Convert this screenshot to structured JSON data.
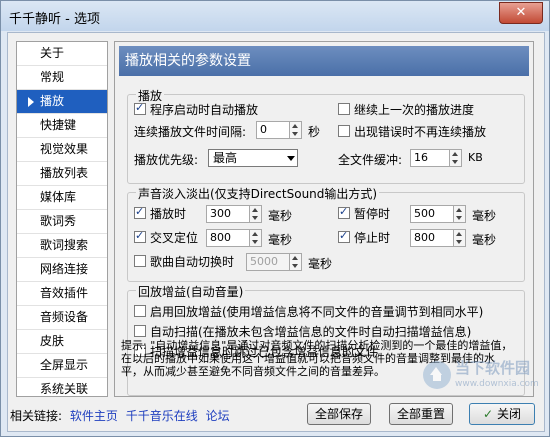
{
  "window": {
    "title": "千千静听 - 选项"
  },
  "sidebar": {
    "items": [
      {
        "label": "关于"
      },
      {
        "label": "常规"
      },
      {
        "label": "播放",
        "active": true
      },
      {
        "label": "快捷键"
      },
      {
        "label": "视觉效果"
      },
      {
        "label": "播放列表"
      },
      {
        "label": "媒体库"
      },
      {
        "label": "歌词秀"
      },
      {
        "label": "歌词搜索"
      },
      {
        "label": "网络连接"
      },
      {
        "label": "音效插件"
      },
      {
        "label": "音频设备"
      },
      {
        "label": "皮肤"
      },
      {
        "label": "全屏显示"
      },
      {
        "label": "系统关联"
      }
    ]
  },
  "panel": {
    "header": "播放相关的参数设置",
    "playback": {
      "title": "播放",
      "auto_play": {
        "label": "程序启动时自动播放",
        "checked": true
      },
      "resume": {
        "label": "继续上一次的播放进度",
        "checked": false
      },
      "interval_label": "连续播放文件时间隔:",
      "interval_value": "0",
      "interval_unit": "秒",
      "stop_on_error": {
        "label": "出现错误时不再连续播放",
        "checked": false
      },
      "priority_label": "播放优先级:",
      "priority_value": "最高",
      "buffer_label": "全文件缓冲:",
      "buffer_value": "16",
      "buffer_unit": "KB"
    },
    "fade": {
      "title": "声音淡入淡出(仅支持DirectSound输出方式)",
      "play": {
        "label": "播放时",
        "checked": true,
        "value": "300",
        "unit": "毫秒"
      },
      "pause": {
        "label": "暂停时",
        "checked": true,
        "value": "500",
        "unit": "毫秒"
      },
      "seek": {
        "label": "交叉定位",
        "checked": true,
        "value": "800",
        "unit": "毫秒"
      },
      "stop": {
        "label": "停止时",
        "checked": true,
        "value": "800",
        "unit": "毫秒"
      },
      "auto_switch": {
        "label": "歌曲自动切换时",
        "checked": false,
        "value": "5000",
        "unit": "毫秒"
      }
    },
    "gain": {
      "title": "回放增益(自动音量)",
      "enable": {
        "label": "启用回放增益(使用增益信息将不同文件的音量调节到相同水平)",
        "checked": false
      },
      "auto_scan": {
        "label": "自动扫描(在播放未包含增益信息的文件时自动扫描增益信息)",
        "checked": false
      },
      "skip_scan": {
        "label": "扫描增益信息时跳过已包含增益信息的文件",
        "checked": false
      }
    },
    "tip": "提示: \"自动增益信息\"是通过对音频文件的扫描分析检测到的一个最佳的增益值，在以后的播放中如果使用这个增益值就可以把音频文件的音量调整到最佳的水平，从而减少甚至避免不同音频文件之间的音量差异。"
  },
  "footer": {
    "links_label": "相关链接:",
    "link_home": "软件主页",
    "link_online": "千千音乐在线",
    "link_forum": "论坛",
    "save_all": "全部保存",
    "reset_all": "全部重置",
    "close": "关闭"
  },
  "watermark": {
    "text": "当下软件园",
    "sub": "www.downxia.com"
  }
}
